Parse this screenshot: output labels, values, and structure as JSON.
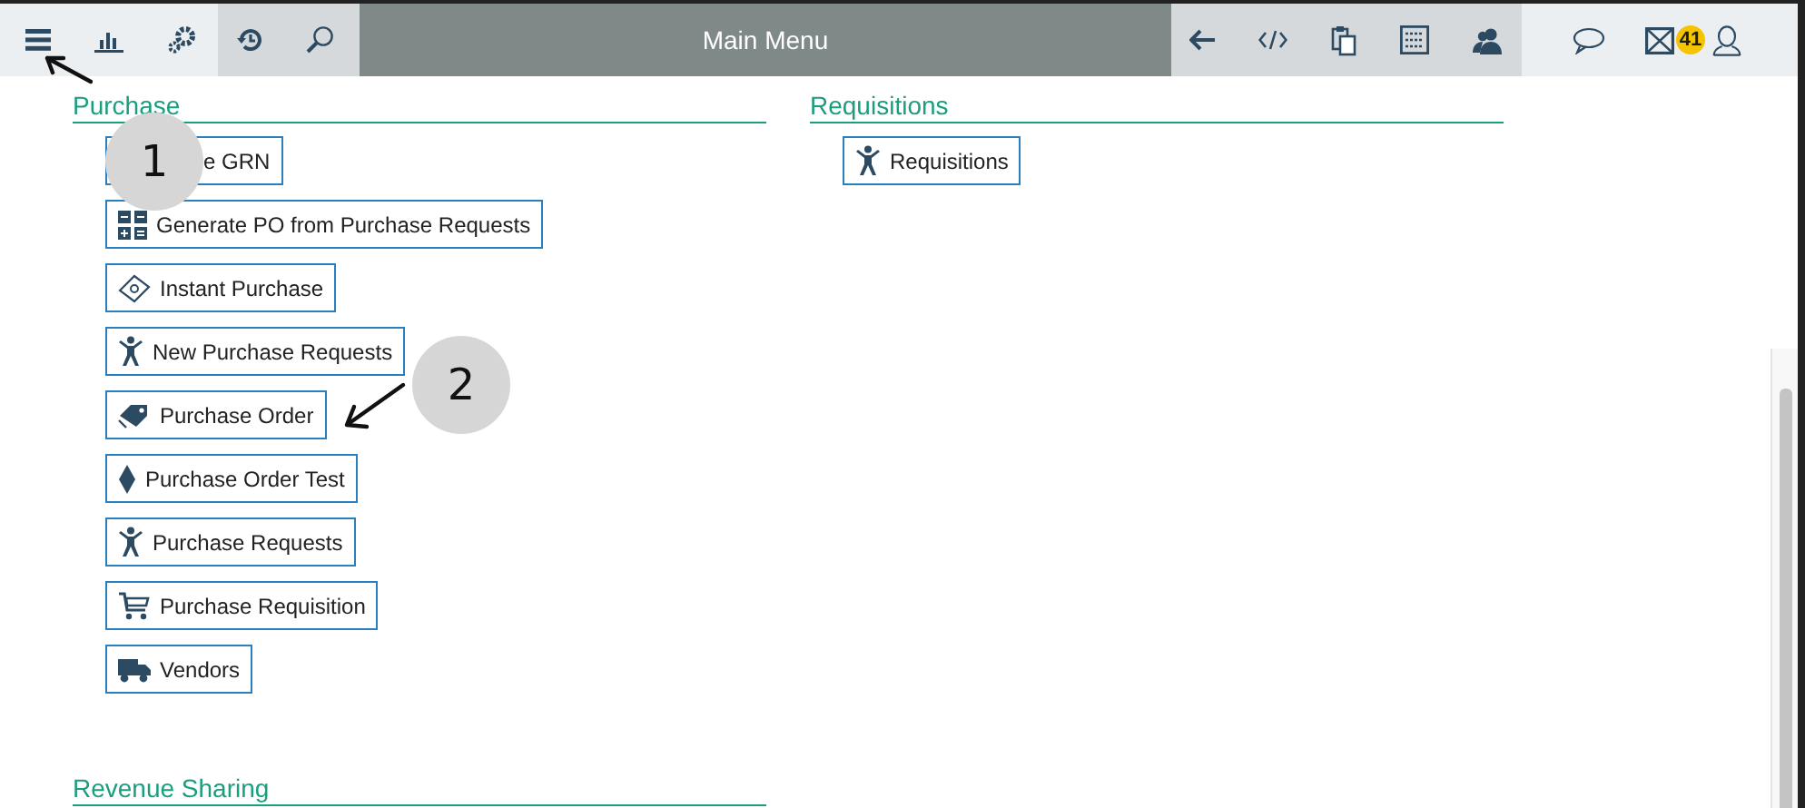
{
  "toolbar": {
    "title": "Main Menu",
    "badge": "41"
  },
  "sections": [
    {
      "title": "Purchase",
      "items": [
        {
          "label": "e GRN"
        },
        {
          "label": "Generate PO from Purchase Requests",
          "kind": "grid"
        },
        {
          "label": "Instant Purchase",
          "kind": "ticket"
        },
        {
          "label": "New Purchase Requests",
          "kind": "person"
        },
        {
          "label": "Purchase Order",
          "kind": "tag"
        },
        {
          "label": "Purchase Order Test",
          "kind": "diamond"
        },
        {
          "label": "Purchase Requests",
          "kind": "person"
        },
        {
          "label": "Purchase Requisition",
          "kind": "cart"
        },
        {
          "label": "Vendors",
          "kind": "truck"
        }
      ]
    },
    {
      "title": "Requisitions",
      "items": [
        {
          "label": "Requisitions",
          "kind": "person"
        }
      ]
    },
    {
      "title": "Revenue Sharing"
    }
  ],
  "annotations": [
    {
      "label": "1"
    },
    {
      "label": "2"
    }
  ]
}
